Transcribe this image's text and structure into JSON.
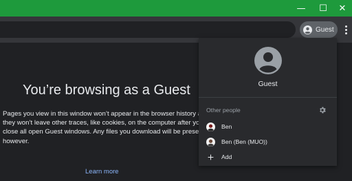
{
  "window": {
    "accent_color": "#1e9a3c",
    "controls": {
      "minimize": "—",
      "maximize": "☐",
      "close": "✕"
    }
  },
  "toolbar": {
    "profile_chip": {
      "label": "Guest",
      "icon": "guest-avatar-icon"
    },
    "menu_icon": "more-vert-icon"
  },
  "page": {
    "heading": "You’re browsing as a Guest",
    "body": "Pages you view in this window won’t appear in the browser history and they won’t leave other traces, like cookies, on the computer after you close all open Guest windows. Any files you download will be preserved, however.",
    "learn_more": "Learn more"
  },
  "profile_menu": {
    "current_profile": "Guest",
    "section_title": "Other people",
    "settings_icon": "gear-icon",
    "people": [
      {
        "name": "Ben",
        "icon": "profile-avatar-icon"
      },
      {
        "name": "Ben (Ben (MUO))",
        "icon": "profile-avatar-icon"
      }
    ],
    "add_label": "Add"
  }
}
